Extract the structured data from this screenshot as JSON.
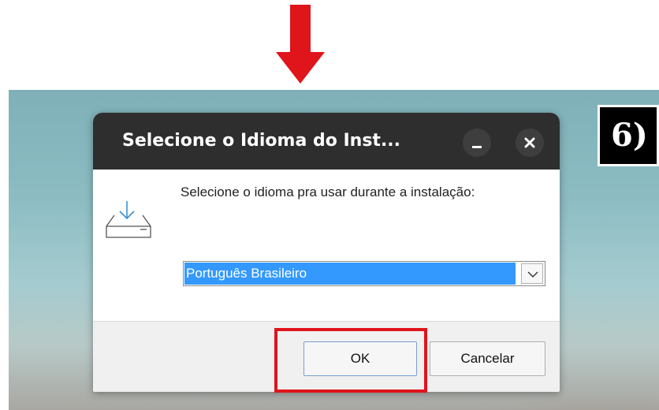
{
  "annotation": {
    "step_label": "6)",
    "arrow_color": "#e0141b",
    "highlight_color": "#e0141b"
  },
  "dialog": {
    "title": "Selecione o Idioma do Inst...",
    "icons": {
      "minimize": "minimize-icon",
      "close": "close-icon",
      "installer": "download-tray-icon",
      "dropdown": "chevron-down-icon"
    },
    "prompt": "Selecione o idioma pra usar durante a instalação:",
    "language_select": {
      "selected": "Português Brasileiro"
    },
    "buttons": {
      "ok": "OK",
      "cancel": "Cancelar"
    },
    "colors": {
      "titlebar": "#2e2e2e",
      "selection": "#3399ff"
    }
  }
}
